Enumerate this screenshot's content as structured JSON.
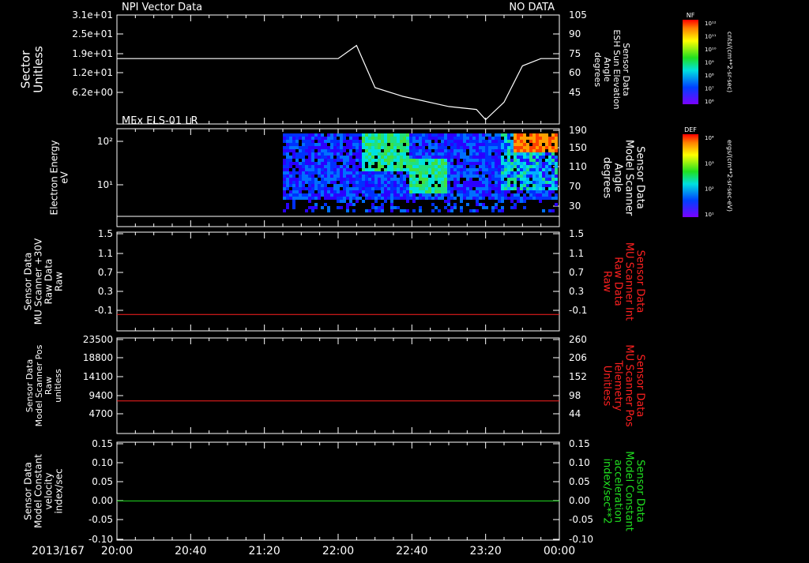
{
  "colors": {
    "background": "#000000",
    "axes": "#ffffff",
    "red": "#ff2020",
    "green": "#20e020"
  },
  "chart_data": [
    {
      "type": "line",
      "id": "p1",
      "title": "NPI Vector Data",
      "status": "NO DATA",
      "ylabel": [
        "Sector",
        "Unitless"
      ],
      "yticks": [
        "3.1e+01",
        "2.5e+01",
        "1.9e+01",
        "1.2e+01",
        "6.2e+00"
      ],
      "ylabel_right": [
        "Sensor Data",
        "ESH Sun Elevation",
        "Angle",
        "degrees"
      ],
      "yticks_right": [
        "105",
        "90",
        "75",
        "60",
        "45"
      ],
      "ylim_right": [
        30,
        105
      ],
      "series": [
        {
          "name": "",
          "color": "#ffffff",
          "x": [
            "20:00",
            "22:00",
            "22:10",
            "22:20",
            "22:35",
            "23:00",
            "23:15",
            "23:20",
            "23:30",
            "23:40",
            "23:50",
            "00:00"
          ],
          "y": [
            75,
            75,
            84,
            55,
            49,
            42,
            40,
            33,
            45,
            70,
            75,
            75
          ]
        }
      ]
    },
    {
      "type": "heatmap",
      "id": "p2",
      "title": "MEx ELS-01 LR",
      "ylabel": [
        "Electron Energy",
        "eV"
      ],
      "yticks": [
        "10²",
        "10¹"
      ],
      "ylabel_right": [
        "Sensor Data",
        "Model Scanner",
        "Angle",
        "degrees"
      ],
      "yticks_right": [
        "190",
        "150",
        "110",
        "70",
        "30"
      ],
      "data_start": "21:30",
      "colorbar": {
        "label": "DEF",
        "units": "ergs/(cm**2-sr-sec-eV)",
        "ticks": [
          "10⁴",
          "10³",
          "10²",
          "10¹"
        ]
      }
    },
    {
      "type": "line",
      "id": "p3",
      "ylabel": [
        "Sensor Data",
        "MU Scanner +30V",
        "Raw Data",
        "Raw"
      ],
      "yticks": [
        "1.5",
        "1.1",
        "0.7",
        "0.3",
        "-0.1"
      ],
      "ylim": [
        -0.3,
        1.5
      ],
      "ylabel_right": [
        "Sensor Data",
        "MU Scanner Int",
        "Raw Data",
        "Raw"
      ],
      "yticks_right": [
        "1.5",
        "1.1",
        "0.7",
        "0.3",
        "-0.1"
      ],
      "series": [
        {
          "name": "",
          "color": "#ff2020",
          "x": [
            "20:00",
            "00:00"
          ],
          "y": [
            0.0,
            0.0
          ]
        }
      ]
    },
    {
      "type": "line",
      "id": "p4",
      "ylabel": [
        "Sensor Data",
        "Model Scanner Pos",
        "Raw",
        "unitless"
      ],
      "yticks": [
        "23500",
        "18800",
        "14100",
        "9400",
        "4700"
      ],
      "ylim": [
        0,
        23500
      ],
      "ylabel_right": [
        "Sensor Data",
        "MU Scanner Pos",
        "Telemetry",
        "Unitless"
      ],
      "yticks_right": [
        "260",
        "206",
        "152",
        "98",
        "44"
      ],
      "series": [
        {
          "name": "",
          "color": "#ff2020",
          "x": [
            "20:00",
            "00:00"
          ],
          "y": [
            8000,
            8000
          ]
        }
      ]
    },
    {
      "type": "line",
      "id": "p5",
      "ylabel": [
        "Sensor Data",
        "Model Constant",
        "velocity",
        "index/sec"
      ],
      "yticks": [
        "0.15",
        "0.10",
        "0.05",
        "0.00",
        "-0.05",
        "-0.10"
      ],
      "ylim": [
        -0.1,
        0.15
      ],
      "ylabel_right": [
        "Sensor Data",
        "Model Constant",
        "acceleration",
        "index/sec**2"
      ],
      "yticks_right": [
        "0.15",
        "0.10",
        "0.05",
        "0.00",
        "-0.05",
        "-0.10"
      ],
      "series": [
        {
          "name": "",
          "color": "#20e020",
          "x": [
            "20:00",
            "00:00"
          ],
          "y": [
            0.0,
            0.0
          ]
        }
      ]
    }
  ],
  "colorbar_top": {
    "label": "NF",
    "units": "cnts/(cm**2-sr-sec)",
    "ticks": [
      "10¹²",
      "10¹¹",
      "10¹⁰",
      "10⁹",
      "10⁸",
      "10⁷",
      "10⁶"
    ]
  },
  "xaxis": {
    "date": "2013/167",
    "ticks": [
      "20:00",
      "20:40",
      "21:20",
      "22:00",
      "22:40",
      "23:20",
      "00:00"
    ]
  }
}
